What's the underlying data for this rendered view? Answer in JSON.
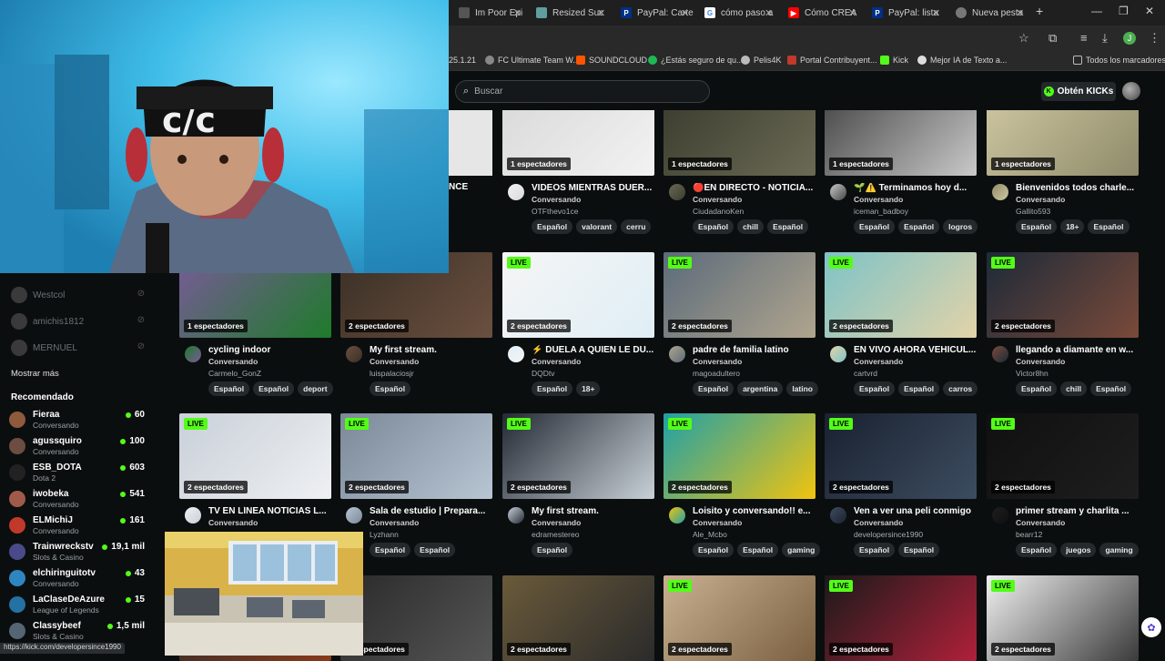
{
  "browser": {
    "tabs": [
      {
        "label": "Im Poor Epi",
        "color": "#e0e0e0",
        "glyph": ""
      },
      {
        "label": "Resized Suc",
        "color": "#5f9ea0",
        "glyph": "■"
      },
      {
        "label": "PayPal: Carte",
        "color": "#003087",
        "glyph": "P"
      },
      {
        "label": "cómo paso a",
        "color": "#4285f4",
        "glyph": "G"
      },
      {
        "label": "Cómo CREA",
        "color": "#ff0000",
        "glyph": "▶"
      },
      {
        "label": "PayPal: lista",
        "color": "#003087",
        "glyph": "P"
      },
      {
        "label": "Nueva pesta",
        "color": "#777777",
        "glyph": "●"
      }
    ],
    "profile_initial": "J",
    "bookmarks": [
      {
        "label": "25.1.21",
        "color": ""
      },
      {
        "label": "FC Ultimate Team W...",
        "color": "#888888"
      },
      {
        "label": "SOUNDCLOUD",
        "color": "#ff5500"
      },
      {
        "label": "¿Estás seguro de qu...",
        "color": "#1db954"
      },
      {
        "label": "Pelis4K",
        "color": "#bbbbbb"
      },
      {
        "label": "Portal Contribuyent...",
        "color": "#c0392b"
      },
      {
        "label": "Kick",
        "color": "#53fc18"
      },
      {
        "label": "Mejor IA de Texto a...",
        "color": "#dddddd"
      },
      {
        "label": "Todos los marcadores",
        "color": ""
      }
    ]
  },
  "header": {
    "search_placeholder": "Buscar",
    "kicks_button": "Obtén KICKs"
  },
  "sidebar": {
    "offline": [
      {
        "name": "Westcol"
      },
      {
        "name": "amichis1812"
      },
      {
        "name": "MERNUEL"
      }
    ],
    "show_more": "Mostrar más",
    "recommended_title": "Recomendado",
    "recommended": [
      {
        "name": "Fieraa",
        "category": "Conversando",
        "viewers": "60",
        "color": "#8e5a3c"
      },
      {
        "name": "agussquiro",
        "category": "Conversando",
        "viewers": "100",
        "color": "#6d4c41"
      },
      {
        "name": "ESB_DOTA",
        "category": "Dota 2",
        "viewers": "603",
        "color": "#222222"
      },
      {
        "name": "iwobeka",
        "category": "Conversando",
        "viewers": "541",
        "color": "#a05a4a"
      },
      {
        "name": "ELMichiJ",
        "category": "Conversando",
        "viewers": "161",
        "color": "#c0392b"
      },
      {
        "name": "Trainwreckstv",
        "category": "Slots & Casino",
        "viewers": "19,1 mil",
        "color": "#4a4a8a"
      },
      {
        "name": "elchiringuitotv",
        "category": "Conversando",
        "viewers": "43",
        "color": "#2e86c1"
      },
      {
        "name": "LaClaseDeAzure",
        "category": "League of Legends",
        "viewers": "15",
        "color": "#2471a3"
      },
      {
        "name": "Classybeef",
        "category": "Slots & Casino",
        "viewers": "1,5 mil",
        "color": "#566573"
      }
    ]
  },
  "grid": {
    "row1": [
      {
        "title": "",
        "title_partial": "NCE",
        "category": "",
        "channel": "",
        "viewers": "",
        "tags": []
      },
      {
        "title": "VIDEOS MIENTRAS DUER...",
        "category": "Conversando",
        "channel": "OTFthevo1ce",
        "viewers": "1 espectadores",
        "tags": [
          "Español",
          "valorant",
          "cerru"
        ]
      },
      {
        "title": "🔴EN DIRECTO - NOTICIA...",
        "category": "Conversando",
        "channel": "CiudadanoKen",
        "viewers": "1 espectadores",
        "tags": [
          "Español",
          "chill",
          "Español"
        ]
      },
      {
        "title": "🌱⚠️ Terminamos hoy d...",
        "category": "Conversando",
        "channel": "iceman_badboy",
        "viewers": "1 espectadores",
        "tags": [
          "Español",
          "Español",
          "logros"
        ]
      },
      {
        "title": "Bienvenidos todos charle...",
        "category": "Conversando",
        "channel": "Gallito593",
        "viewers": "1 espectadores",
        "tags": [
          "Español",
          "18+",
          "Español"
        ]
      }
    ],
    "row2": [
      {
        "title": "cycling indoor",
        "category": "Conversando",
        "channel": "Carmelo_GonZ",
        "viewers": "1 espectadores",
        "live": "",
        "tags": [
          "Español",
          "Español",
          "deport"
        ]
      },
      {
        "title": "My first stream.",
        "category": "Conversando",
        "channel": "luispalaciosjr",
        "viewers": "2 espectadores",
        "live": "",
        "tags": [
          "Español"
        ]
      },
      {
        "title": "⚡ DUELA A QUIEN LE DU...",
        "category": "Conversando",
        "channel": "DQDtv",
        "viewers": "2 espectadores",
        "live": "LIVE",
        "tags": [
          "Español",
          "18+"
        ]
      },
      {
        "title": "padre de familia latino",
        "category": "Conversando",
        "channel": "magoadultero",
        "viewers": "2 espectadores",
        "live": "LIVE",
        "tags": [
          "Español",
          "argentina",
          "latino"
        ]
      },
      {
        "title": "EN VIVO AHORA VEHICUL...",
        "category": "Conversando",
        "channel": "cartvrd",
        "viewers": "2 espectadores",
        "live": "LIVE",
        "tags": [
          "Español",
          "Español",
          "carros"
        ]
      },
      {
        "title": "llegando a diamante en w...",
        "category": "Conversando",
        "channel": "Victor8hn",
        "viewers": "2 espectadores",
        "live": "LIVE",
        "tags": [
          "Español",
          "chill",
          "Español"
        ]
      }
    ],
    "row3": [
      {
        "title": "TV EN LÍNEA NOTICIAS L...",
        "category": "Conversando",
        "channel": "",
        "viewers": "2 espectadores",
        "live": "LIVE",
        "tags": []
      },
      {
        "title": "Sala de estudio | Prepara...",
        "category": "Conversando",
        "channel": "Lyzhann",
        "viewers": "2 espectadores",
        "live": "LIVE",
        "tags": [
          "Español",
          "Español"
        ]
      },
      {
        "title": "My first stream.",
        "category": "Conversando",
        "channel": "edramestereo",
        "viewers": "2 espectadores",
        "live": "LIVE",
        "tags": [
          "Español"
        ]
      },
      {
        "title": "Loisito y conversando!! e...",
        "category": "Conversando",
        "channel": "Ale_Mcbo",
        "viewers": "2 espectadores",
        "live": "LIVE",
        "tags": [
          "Español",
          "Español",
          "gaming"
        ]
      },
      {
        "title": "Ven a ver una peli conmigo",
        "category": "Conversando",
        "channel": "developersince1990",
        "viewers": "2 espectadores",
        "live": "LIVE",
        "tags": [
          "Español",
          "Español"
        ]
      },
      {
        "title": "primer stream y charlita ...",
        "category": "Conversando",
        "channel": "bearr12",
        "viewers": "2 espectadores",
        "live": "LIVE",
        "tags": [
          "Español",
          "juegos",
          "gaming"
        ]
      }
    ],
    "row4": [
      {
        "viewers": "2 espectadores",
        "live": ""
      },
      {
        "viewers": "2 espectadores",
        "live": ""
      },
      {
        "viewers": "2 espectadores",
        "live": ""
      },
      {
        "viewers": "2 espectadores",
        "live": "LIVE"
      },
      {
        "viewers": "2 espectadores",
        "live": "LIVE"
      },
      {
        "viewers": "2 espectadores",
        "live": "LIVE"
      }
    ]
  },
  "overlay_text": {
    "thumb_text_row3_3": "CIUDAESTEREO",
    "status_url": "https://kick.com/developersince1990"
  }
}
